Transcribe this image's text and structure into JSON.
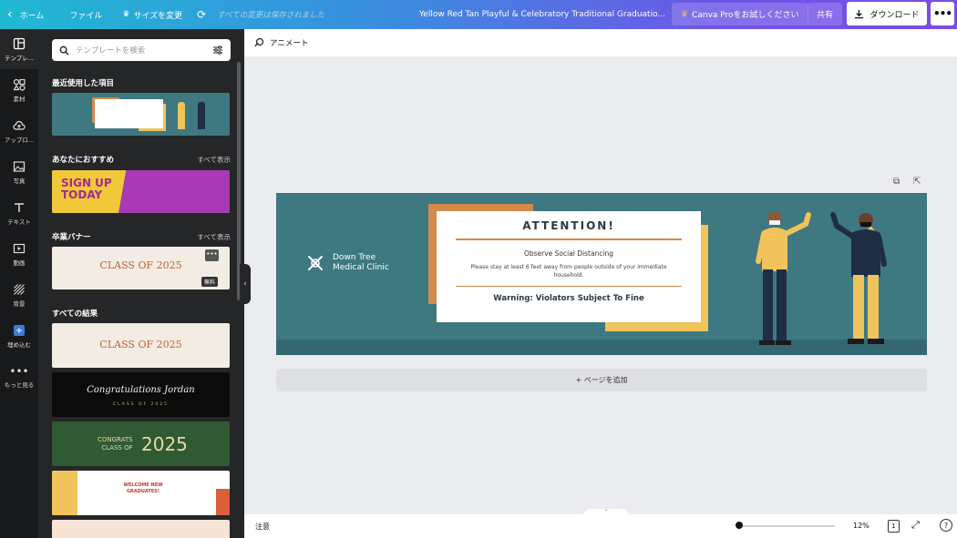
{
  "topbar": {
    "home": "ホーム",
    "file": "ファイル",
    "resize": "サイズを変更",
    "saved_status": "すべての変更は保存されました",
    "doc_title": "Yellow Red Tan Playful & Celebratory Traditional Graduatio...",
    "pro": "Canva Proをお試しください",
    "share": "共有",
    "download": "ダウンロード"
  },
  "rail": {
    "templates": "テンプレ...",
    "elements": "素材",
    "uploads": "アップロ...",
    "photos": "写真",
    "text": "テキスト",
    "videos": "動画",
    "background": "背景",
    "embed": "埋め込む",
    "more": "もっと見る"
  },
  "panel": {
    "search_placeholder": "テンプレートを検索",
    "recent": "最近使用した項目",
    "recommended": "あなたにおすすめ",
    "see_all": "すべて表示",
    "graduation": "卒業バナー",
    "all_results": "すべての結果",
    "free_badge": "無料",
    "thumb_recommended_title": "SIGN UP TODAY",
    "thumb_class": "CLASS OF 2025",
    "thumb_congrats": "Congratulations Jordan",
    "thumb_congrats_sub": "CLASS OF 2025",
    "thumb_green_a": "CONGRATS",
    "thumb_green_b": "CLASS OF",
    "thumb_green_year": "2025",
    "thumb_welcome": "WELCOME NEW GRADUATES!"
  },
  "editor": {
    "animate": "アニメート",
    "add_page": "+ ページを追加"
  },
  "banner": {
    "clinic_line1": "Down Tree",
    "clinic_line2": "Medical Clinic",
    "attention": "ATTENTION!",
    "subtitle": "Observe Social Distancing",
    "body": "Please stay at least 6 feet away from people outside of your immediate household.",
    "warning": "Warning: Violators Subject To Fine"
  },
  "bottombar": {
    "notes": "注意",
    "zoom": "12%",
    "page": "1",
    "zoom_fraction": 0.0
  },
  "colors": {
    "banner_teal": "#3e7881",
    "accent_orange": "#d38a4c",
    "accent_yellow": "#f0c35b",
    "rail_bg": "#18191b",
    "panel_bg": "#252627"
  }
}
